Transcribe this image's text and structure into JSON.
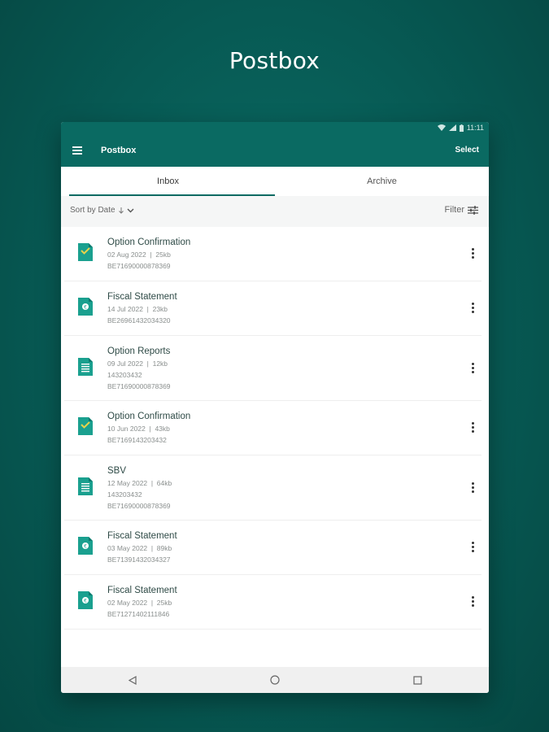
{
  "hero_title": "Postbox",
  "status": {
    "time": "11:11"
  },
  "appbar": {
    "title": "Postbox",
    "select_label": "Select"
  },
  "tabs": [
    {
      "label": "Inbox",
      "active": true
    },
    {
      "label": "Archive",
      "active": false
    }
  ],
  "sortbar": {
    "sort_label": "Sort by Date",
    "filter_label": "Filter"
  },
  "items": [
    {
      "title": "Option Confirmation",
      "meta": "02 Aug 2022  |  25kb",
      "lines": [
        "BE71690000878369"
      ],
      "icon": "doc-check-icon"
    },
    {
      "title": "Fiscal Statement",
      "meta": "14 Jul 2022  |  23kb",
      "lines": [
        "BE26961432034320"
      ],
      "icon": "doc-euro-icon"
    },
    {
      "title": "Option Reports",
      "meta": "09 Jul 2022  |  12kb",
      "lines": [
        "143203432",
        "BE71690000878369"
      ],
      "icon": "doc-list-icon"
    },
    {
      "title": "Option Confirmation",
      "meta": "10 Jun 2022  |  43kb",
      "lines": [
        "BE7169143203432"
      ],
      "icon": "doc-check-icon"
    },
    {
      "title": "SBV",
      "meta": "12 May 2022  |  64kb",
      "lines": [
        "143203432",
        "BE71690000878369"
      ],
      "icon": "doc-list-icon"
    },
    {
      "title": "Fiscal Statement",
      "meta": "03 May 2022  |  89kb",
      "lines": [
        "BE71391432034327"
      ],
      "icon": "doc-euro-icon"
    },
    {
      "title": "Fiscal Statement",
      "meta": "02 May 2022  |  25kb",
      "lines": [
        "BE71271402111846"
      ],
      "icon": "doc-euro-icon"
    }
  ],
  "colors": {
    "primary": "#0a6a62",
    "icon_teal": "#1aa08f"
  }
}
